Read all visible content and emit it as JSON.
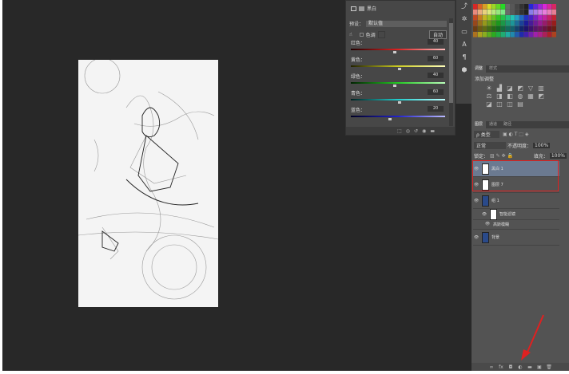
{
  "properties": {
    "title": "黑白",
    "preset_label": "预设：",
    "preset_value": "默认值",
    "tint_label": "色调",
    "auto_label": "自动",
    "sliders": [
      {
        "label": "红色：",
        "value": "40",
        "pos": 0.45,
        "grad": "linear-gradient(90deg,#200,#d22,#fbb)"
      },
      {
        "label": "黄色：",
        "value": "60",
        "pos": 0.5,
        "grad": "linear-gradient(90deg,#220,#cc2,#ffb)"
      },
      {
        "label": "绿色：",
        "value": "40",
        "pos": 0.45,
        "grad": "linear-gradient(90deg,#020,#2c2,#bfb)"
      },
      {
        "label": "青色：",
        "value": "60",
        "pos": 0.5,
        "grad": "linear-gradient(90deg,#022,#2cc,#bff)"
      },
      {
        "label": "蓝色：",
        "value": "20",
        "pos": 0.4,
        "grad": "linear-gradient(90deg,#002,#22c,#bbf)"
      }
    ]
  },
  "adjustments": {
    "tabs": [
      "调整",
      "样式"
    ],
    "heading": "添加调整",
    "icons": [
      "☀",
      "▟",
      "◪",
      "◩",
      "▽",
      "▥",
      "⚖",
      "◨",
      "◧",
      "◍",
      "▦",
      "◩",
      "◪",
      "◫",
      "◫",
      "▤"
    ]
  },
  "layers": {
    "tabs": [
      "图层",
      "通道",
      "路径"
    ],
    "kind": "ρ 类型",
    "blend": "正常",
    "opacity_label": "不透明度：",
    "opacity": "100%",
    "lock_label": "锁定：",
    "fill_label": "填充：",
    "fill": "100%",
    "items": [
      {
        "name": "黑白 1",
        "selected": true
      },
      {
        "name": "图层 7",
        "selected": false
      },
      {
        "name": "组 1",
        "selected": false
      },
      {
        "name": "智能滤镜",
        "selected": false
      },
      {
        "name": "高斯模糊",
        "selected": false
      },
      {
        "name": "背景",
        "selected": false
      }
    ],
    "footer_icons": [
      "∞",
      "fx",
      "◘",
      "◐",
      "▬",
      "▣",
      "🗑"
    ]
  },
  "annotation_color": "#e02020"
}
